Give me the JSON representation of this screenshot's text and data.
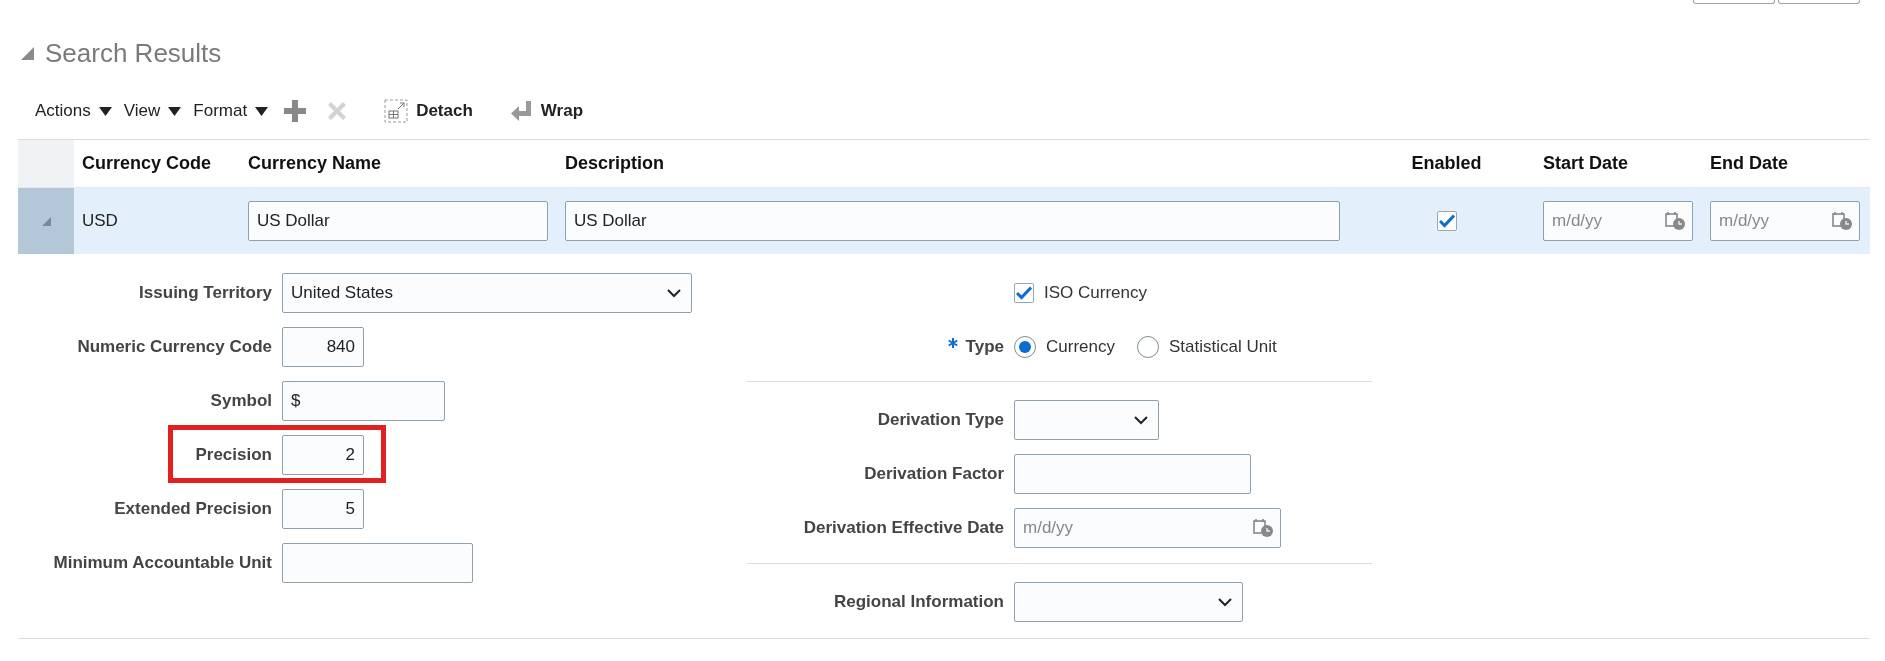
{
  "section": {
    "title": "Search Results",
    "expanded": true
  },
  "toolbar": {
    "menus": [
      {
        "label": "Actions"
      },
      {
        "label": "View"
      },
      {
        "label": "Format"
      }
    ],
    "buttons": [
      {
        "kind": "add",
        "disabled": false
      },
      {
        "kind": "delete",
        "disabled": true
      },
      {
        "kind": "detach",
        "label": "Detach",
        "disabled": false
      },
      {
        "kind": "wrap",
        "label": "Wrap",
        "disabled": false
      }
    ]
  },
  "table": {
    "columns": [
      "Currency Code",
      "Currency Name",
      "Description",
      "Enabled",
      "Start Date",
      "End Date"
    ],
    "rows": [
      {
        "selected": true,
        "expanded": true,
        "currency_code": "USD",
        "currency_name": "US Dollar",
        "description": "US Dollar",
        "enabled": true,
        "start_date": {
          "placeholder": "m/d/yy"
        },
        "end_date": {
          "placeholder": "m/d/yy"
        }
      }
    ]
  },
  "details": {
    "left": [
      {
        "kind": "select",
        "label": "Issuing Territory",
        "value": "United States"
      },
      {
        "kind": "number",
        "label": "Numeric Currency Code",
        "value": "840"
      },
      {
        "kind": "text",
        "label": "Symbol",
        "value": "$"
      },
      {
        "kind": "number",
        "label": "Precision",
        "value": "2",
        "highlighted": true
      },
      {
        "kind": "number",
        "label": "Extended Precision",
        "value": "5"
      },
      {
        "kind": "text",
        "label": "Minimum Accountable Unit"
      }
    ],
    "right": [
      [
        {
          "kind": "checkbox",
          "label": "ISO Currency",
          "checked": true
        },
        {
          "kind": "radio",
          "label": "Type",
          "required": true,
          "options": [
            {
              "label": "Currency",
              "selected": true
            },
            {
              "label": "Statistical Unit",
              "selected": false
            }
          ]
        }
      ],
      [
        {
          "kind": "select",
          "label": "Derivation Type"
        },
        {
          "kind": "text",
          "label": "Derivation Factor"
        },
        {
          "kind": "date",
          "label": "Derivation Effective Date",
          "placeholder": "m/d/yy"
        }
      ],
      [
        {
          "kind": "select",
          "label": "Regional Information"
        }
      ]
    ]
  }
}
